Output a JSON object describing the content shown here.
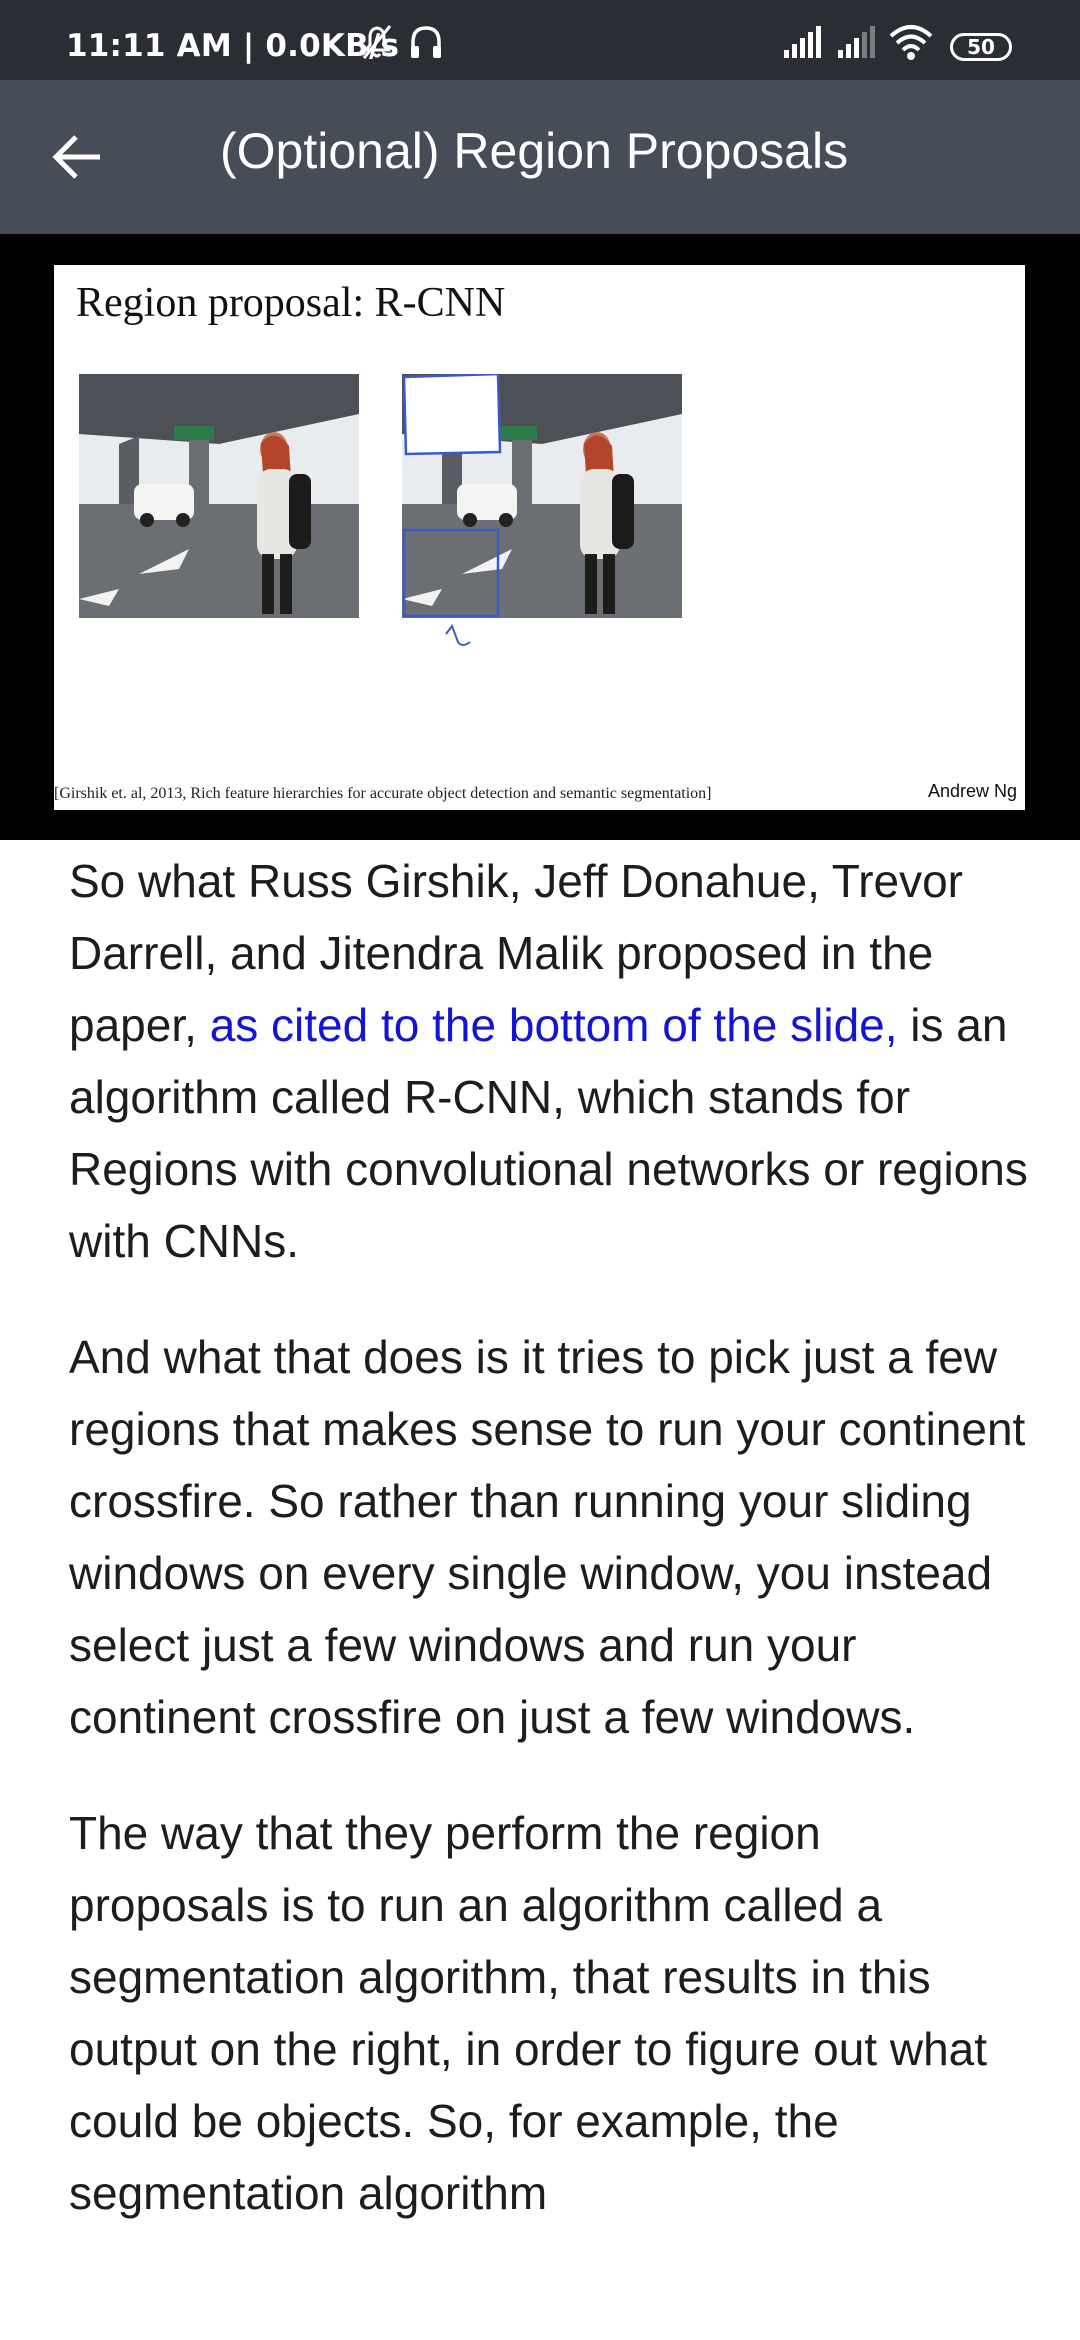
{
  "status_bar": {
    "time": "11:11 AM | 0.0KB/s",
    "battery": "50"
  },
  "header": {
    "title": "(Optional) Region Proposals"
  },
  "slide": {
    "title": "Region proposal: R-CNN",
    "citation": "[Girshik et. al, 2013, Rich feature hierarchies for accurate object detection and semantic segmentation]",
    "author": "Andrew Ng"
  },
  "transcript": {
    "p1_before_link": "So what Russ Girshik, Jeff Donahue, Tre­vor Darrell, and Jitendra Malik proposed in the paper, ",
    "p1_link": "as cited to the bottom of the slide,",
    "p1_after_link": " is an algorithm called R-CNN, which stands for Regions with convolutional networks or regions with CNNs.",
    "p2": "And what that does is it tries to pick just a few regions that makes sense to run your continent crossfire. So rather than running your sliding windows on every single window, you instead select just a few windows and run your continent crossfire on just a few windows.",
    "p3": "The way that they perform the region proposals is to run an algorithm called a segmentation algorithm, that results in this output on the right, in order to figure out what could be objects. So, for example, the segmentation algorithm"
  },
  "colors": {
    "status_bar_bg": "#2a2d33",
    "app_bar_bg": "#474d57",
    "link": "#1414d4",
    "annotation": "#3a5ac8"
  },
  "icons": [
    "muted-bell-icon",
    "headphones-icon",
    "signal-icon",
    "wifi-icon",
    "battery-icon",
    "back-arrow-icon"
  ]
}
